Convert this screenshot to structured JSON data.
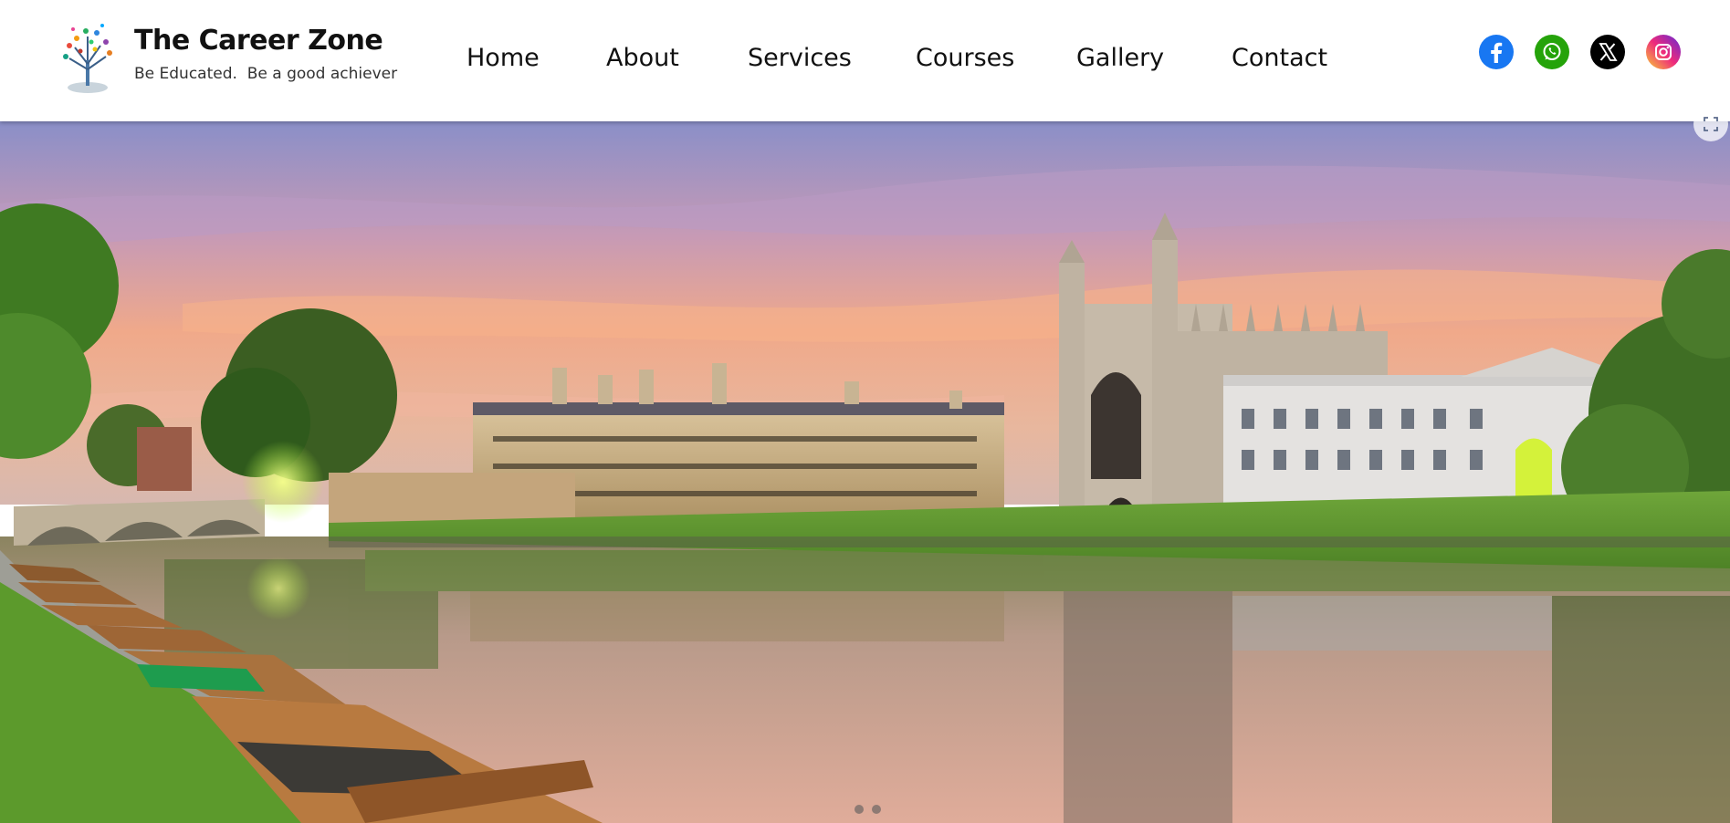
{
  "brand": {
    "title": "The Career Zone",
    "tagline": "Be Educated.  Be a good achiever"
  },
  "nav": [
    {
      "label": "Home"
    },
    {
      "label": "About"
    },
    {
      "label": "Services"
    },
    {
      "label": "Courses"
    },
    {
      "label": "Gallery"
    },
    {
      "label": "Contact"
    }
  ],
  "social": [
    {
      "icon": "facebook-icon",
      "color": "#1877F2"
    },
    {
      "icon": "whatsapp-icon",
      "color": "#25A30A"
    },
    {
      "icon": "x-icon",
      "color": "#000000"
    },
    {
      "icon": "instagram-icon",
      "color": "#DD2A7B"
    }
  ],
  "hero": {
    "image": "kings-college-cambridge-river-view",
    "slides_total": 2,
    "active_slide": 1
  },
  "colors": {
    "header_bg": "#FFFFFF",
    "text": "#111111",
    "sky_top": "#8A8FC8",
    "sky_glow": "#F2A07A",
    "grass": "#5E9A2E"
  }
}
